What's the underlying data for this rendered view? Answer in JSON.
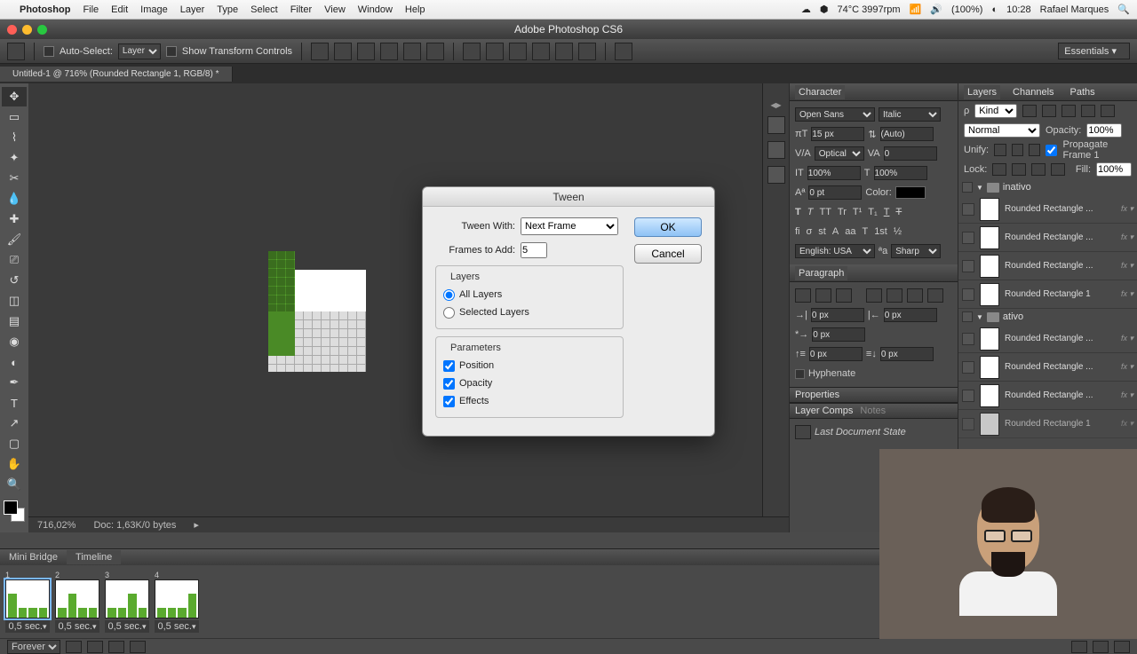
{
  "menubar": {
    "app": "Photoshop",
    "items": [
      "File",
      "Edit",
      "Image",
      "Layer",
      "Type",
      "Select",
      "Filter",
      "View",
      "Window",
      "Help"
    ],
    "right": {
      "temp": "74°C 3997rpm",
      "battery": "(100%)",
      "time": "10:28",
      "user": "Rafael Marques"
    }
  },
  "window": {
    "title": "Adobe Photoshop CS6"
  },
  "options": {
    "auto_select": "Auto-Select:",
    "layer_dd": "Layer",
    "show_transform": "Show Transform Controls",
    "workspace": "Essentials"
  },
  "doc_tab": "Untitled-1 @ 716% (Rounded Rectangle 1, RGB/8) *",
  "status": {
    "zoom": "716,02%",
    "doc": "Doc: 1,63K/0 bytes"
  },
  "dialog": {
    "title": "Tween",
    "tween_with_label": "Tween With:",
    "tween_with_value": "Next Frame",
    "frames_label": "Frames to Add:",
    "frames_value": "5",
    "layers_legend": "Layers",
    "layers_all": "All Layers",
    "layers_selected": "Selected Layers",
    "params_legend": "Parameters",
    "param_position": "Position",
    "param_opacity": "Opacity",
    "param_effects": "Effects",
    "ok": "OK",
    "cancel": "Cancel"
  },
  "char_panel": {
    "title": "Character",
    "font": "Open Sans",
    "style": "Italic",
    "size": "15 px",
    "leading": "(Auto)",
    "kerning": "Optical",
    "tracking": "0",
    "hscale": "100%",
    "vscale": "100%",
    "baseline": "0 pt",
    "color_label": "Color:",
    "lang": "English: USA",
    "aa": "Sharp"
  },
  "para_panel": {
    "title": "Paragraph",
    "indent_left": "0 px",
    "indent_right": "0 px",
    "indent_first": "0 px",
    "space_before": "0 px",
    "space_after": "0 px",
    "hyphenate": "Hyphenate"
  },
  "properties": "Properties",
  "layer_comps": {
    "title": "Layer Comps",
    "notes": "Notes",
    "last": "Last Document State"
  },
  "layers_panel": {
    "tabs": [
      "Layers",
      "Channels",
      "Paths"
    ],
    "kind": "Kind",
    "blend": "Normal",
    "opacity_label": "Opacity:",
    "opacity": "100%",
    "unify": "Unify:",
    "propagate": "Propagate Frame 1",
    "lock": "Lock:",
    "fill_label": "Fill:",
    "fill": "100%",
    "groups": [
      {
        "name": "inativo",
        "layers": [
          "Rounded Rectangle ...",
          "Rounded Rectangle ...",
          "Rounded Rectangle ...",
          "Rounded Rectangle 1"
        ]
      },
      {
        "name": "ativo",
        "layers": [
          "Rounded Rectangle ...",
          "Rounded Rectangle ...",
          "Rounded Rectangle ...",
          "Rounded Rectangle 1"
        ]
      }
    ]
  },
  "timeline": {
    "tabs": [
      "Mini Bridge",
      "Timeline"
    ],
    "frames": [
      {
        "num": "1",
        "time": "0,5 sec."
      },
      {
        "num": "2",
        "time": "0,5 sec."
      },
      {
        "num": "3",
        "time": "0,5 sec."
      },
      {
        "num": "4",
        "time": "0,5 sec."
      }
    ],
    "loop": "Forever"
  }
}
